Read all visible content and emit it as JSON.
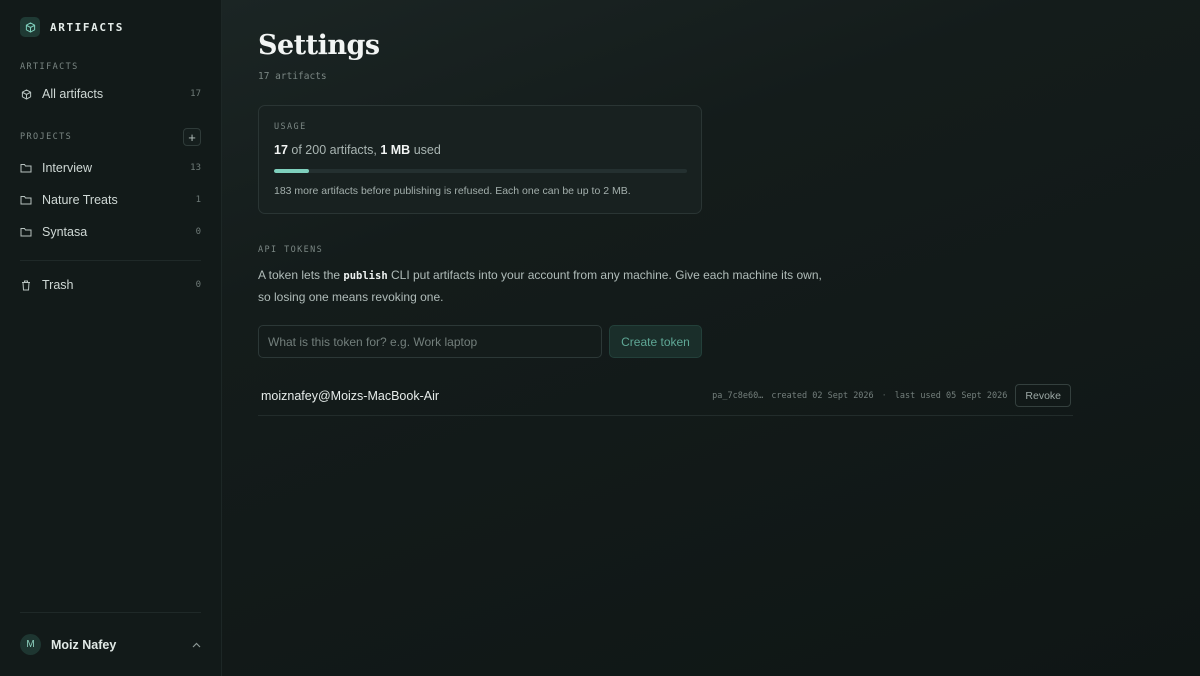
{
  "brand": {
    "name": "ARTIFACTS",
    "icon": "cube-icon"
  },
  "sidebar": {
    "artifacts_label": "ARTIFACTS",
    "all_artifacts": {
      "label": "All artifacts",
      "count": "17",
      "icon": "cube-icon"
    },
    "projects_label": "PROJECTS",
    "add_project_label": "+",
    "projects": [
      {
        "label": "Interview",
        "count": "13",
        "icon": "folder-icon"
      },
      {
        "label": "Nature Treats",
        "count": "1",
        "icon": "folder-icon"
      },
      {
        "label": "Syntasa",
        "count": "0",
        "icon": "folder-icon"
      }
    ],
    "trash": {
      "label": "Trash",
      "count": "0",
      "icon": "trash-icon"
    },
    "user": {
      "initial": "M",
      "name": "Moiz Nafey",
      "chevron": "chevron-up-icon"
    }
  },
  "main": {
    "title": "Settings",
    "subtitle": "17 artifacts",
    "usage": {
      "label": "USAGE",
      "used": "17",
      "of_text": "of 200 artifacts,",
      "size": "1 MB",
      "size_suffix": "used",
      "progress_fraction": 0.085,
      "note": "183 more artifacts before publishing is refused. Each one can be up to 2 MB."
    },
    "tokens": {
      "label": "API TOKENS",
      "desc_prefix": "A token lets the ",
      "desc_code": "publish",
      "desc_line1_rest": " CLI put artifacts into your account from any machine. Give each machine its own,",
      "desc_line2": "so losing one means revoking one.",
      "input_placeholder": "What is this token for? e.g. Work laptop",
      "create_label": "Create token",
      "items": [
        {
          "name": "moiznafey@Moizs-MacBook-Air",
          "token_prefix": "pa_7c8e60…",
          "created": "created 02 Sept 2026",
          "separator": "·",
          "last_used": "last used 05 Sept 2026",
          "revoke_label": "Revoke"
        }
      ]
    }
  },
  "colors": {
    "accent": "#7fd0bd",
    "background": "#101716",
    "sidebar": "#121a19"
  }
}
